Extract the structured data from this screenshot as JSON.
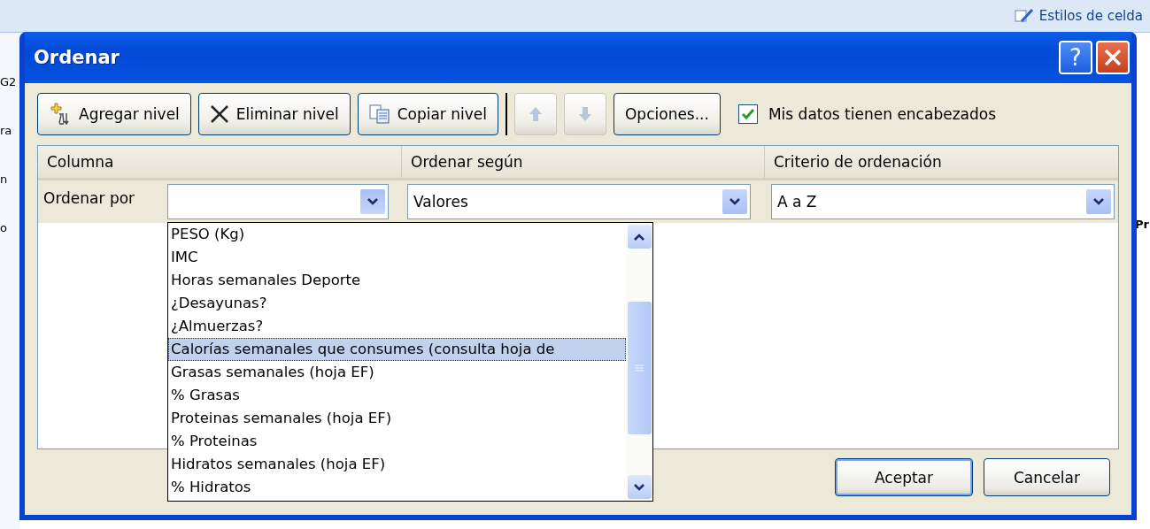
{
  "background": {
    "ribbon_label": "Estilos de celda",
    "left_fragments": [
      "G2",
      "ra",
      "n",
      "o"
    ],
    "right_fragment": "Pr"
  },
  "window": {
    "title": "Ordenar",
    "help": "?"
  },
  "toolbar": {
    "buttons": [
      {
        "kind": "add",
        "label": "Agregar nivel",
        "disabled": false
      },
      {
        "kind": "delete",
        "label": "Eliminar nivel",
        "disabled": false
      },
      {
        "kind": "copy",
        "label": "Copiar nivel",
        "disabled": false
      },
      {
        "kind": "up",
        "disabled": true
      },
      {
        "kind": "down",
        "disabled": true
      },
      {
        "kind": "text",
        "label": "Opciones...",
        "disabled": false
      }
    ],
    "checkbox": {
      "label": "Mis datos tienen encabezados",
      "checked": true
    }
  },
  "grid": {
    "columns": [
      "Columna",
      "Ordenar según",
      "Criterio de ordenación"
    ],
    "rows": [
      {
        "label": "Ordenar por",
        "column": {
          "expanded": true
        },
        "sort_on": "Valores",
        "order": "A a Z"
      }
    ]
  },
  "dropdown": {
    "items": [
      {
        "label": "PESO (Kg)",
        "selected": false
      },
      {
        "label": "IMC",
        "selected": false
      },
      {
        "label": "Horas semanales Deporte",
        "selected": false
      },
      {
        "label": "¿Desayunas?",
        "selected": false
      },
      {
        "label": "¿Almuerzas?",
        "selected": false
      },
      {
        "label": "Calorías semanales que consumes (consulta hoja de",
        "selected": true
      },
      {
        "label": "Grasas semanales (hoja EF)",
        "selected": false
      },
      {
        "label": "% Grasas",
        "selected": false
      },
      {
        "label": "Proteinas semanales (hoja EF)",
        "selected": false
      },
      {
        "label": "% Proteinas",
        "selected": false
      },
      {
        "label": "Hidratos semanales (hoja EF)",
        "selected": false
      },
      {
        "label": "% Hidratos",
        "selected": false
      }
    ]
  },
  "buttons": [
    {
      "label": "Aceptar",
      "default": true
    },
    {
      "label": "Cancelar",
      "default": false
    }
  ]
}
